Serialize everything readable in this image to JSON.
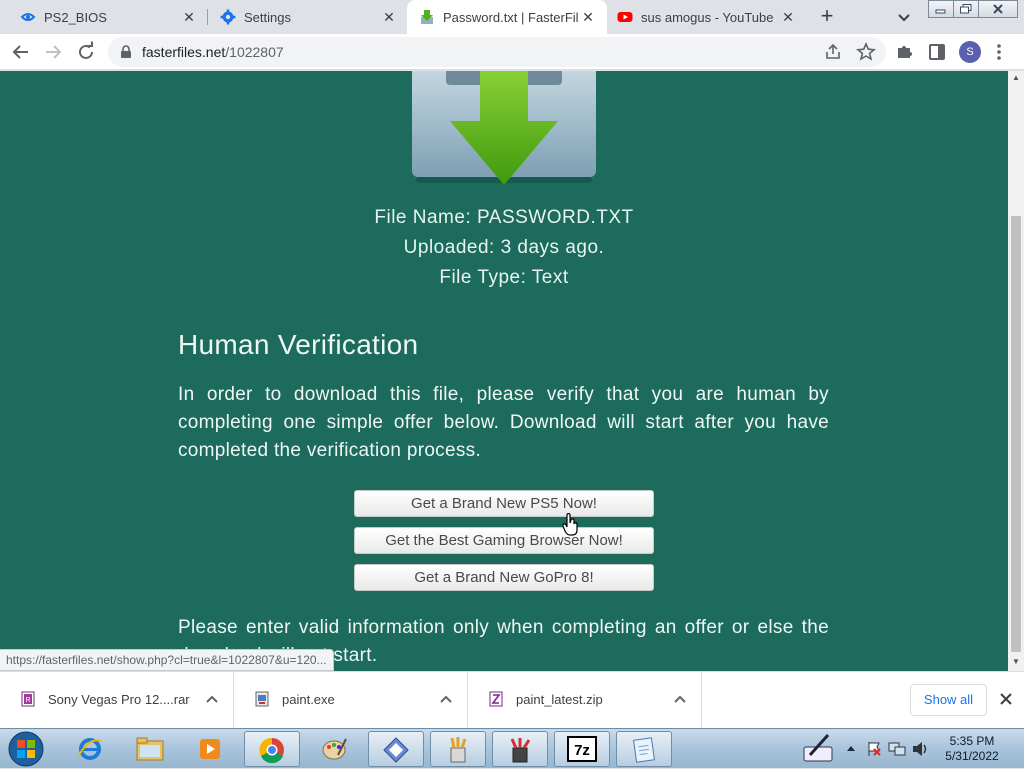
{
  "browser": {
    "tabs": [
      {
        "label": "PS2_BIOS",
        "icon": "ps2-site-icon",
        "active": false
      },
      {
        "label": "Settings",
        "icon": "gear-icon",
        "active": false
      },
      {
        "label": "Password.txt | FasterFiles",
        "icon": "download-icon",
        "active": true
      },
      {
        "label": "sus amogus - YouTube",
        "icon": "youtube-icon",
        "active": false
      }
    ],
    "url_host": "fasterfiles.net",
    "url_path": "/1022807",
    "profile_initial": "S"
  },
  "page": {
    "file_name": "File Name: PASSWORD.TXT",
    "uploaded": "Uploaded: 3 days ago.",
    "file_type": "File Type: Text",
    "hv_title": "Human Verification",
    "hv_text": "In order to download this file, please verify that you are human by completing one simple offer below. Download will start after you have completed the verification process.",
    "offers": [
      "Get a Brand New PS5 Now!",
      "Get the Best Gaming Browser Now!",
      "Get a Brand New GoPro 8!"
    ],
    "notice": "Please enter valid information only when completing an offer or else the download will not start.",
    "status_url": "https://fasterfiles.net/show.php?cl=true&l=1022807&u=120...",
    "bg_color": "#1c6b5d"
  },
  "downloads": {
    "items": [
      {
        "name": "Sony Vegas Pro 12....rar",
        "icon": "winrar-icon"
      },
      {
        "name": "paint.exe",
        "icon": "exe-icon"
      },
      {
        "name": "paint_latest.zip",
        "icon": "zip-icon"
      }
    ],
    "show_all": "Show all"
  },
  "taskbar": {
    "time": "5:35 PM",
    "date": "5/31/2022",
    "apps": [
      "internet-explorer-icon",
      "file-explorer-icon",
      "media-player-icon",
      "chrome-icon",
      "paint-palette-icon",
      "app-icon",
      "paint-brushes-icon",
      "paint-tools-icon",
      "7zip-icon",
      "notepad-icon"
    ]
  }
}
